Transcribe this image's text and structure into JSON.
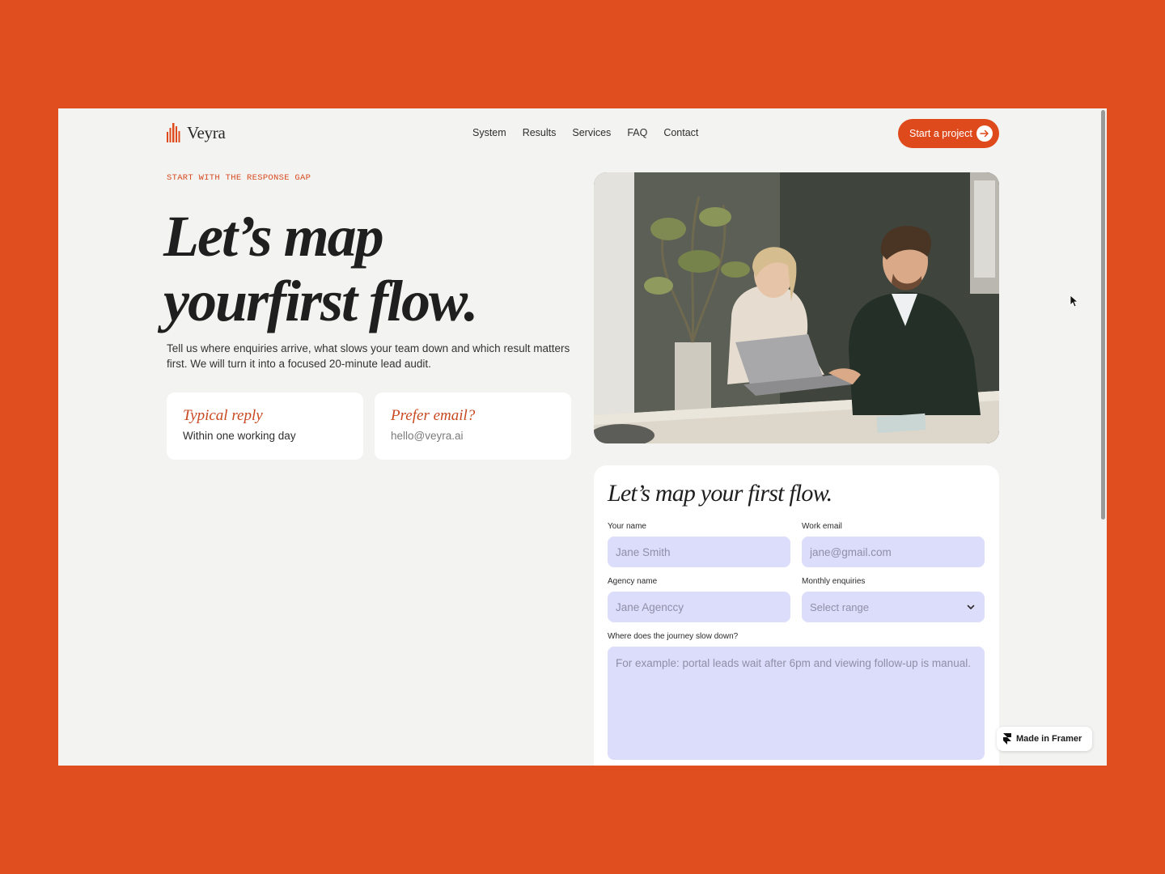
{
  "brand": {
    "name": "Veyra"
  },
  "nav": {
    "links": [
      "System",
      "Results",
      "Services",
      "FAQ",
      "Contact"
    ],
    "cta_label": "Start a project"
  },
  "hero": {
    "eyebrow": "START WITH THE RESPONSE GAP",
    "headline_line1": "Let’s map",
    "headline_line2": "yourfirst flow.",
    "lead": "Tell us where enquiries arrive, what slows your team down and which result matters first. We will turn it into a focused 20-minute lead audit.",
    "cards": [
      {
        "title": "Typical reply",
        "value": "Within one working day"
      },
      {
        "title": "Prefer email?",
        "value": "hello@veyra.ai"
      }
    ]
  },
  "form": {
    "title": "Let’s map your first flow.",
    "name_label": "Your name",
    "name_placeholder": "Jane Smith",
    "email_label": "Work email",
    "email_placeholder": "jane@gmail.com",
    "agency_label": "Agency name",
    "agency_placeholder": "Jane Agenccy",
    "enquiries_label": "Monthly enquiries",
    "enquiries_value": "Select range",
    "journey_label": "Where does the journey slow down?",
    "journey_placeholder": "For example: portal leads wait after 6pm and viewing follow-up is manual."
  },
  "badge": {
    "label": "Made in Framer"
  },
  "colors": {
    "background": "#e04e20",
    "accent": "#df4a1c",
    "page": "#f3f3f1",
    "input_fill": "#dcdcfb"
  }
}
